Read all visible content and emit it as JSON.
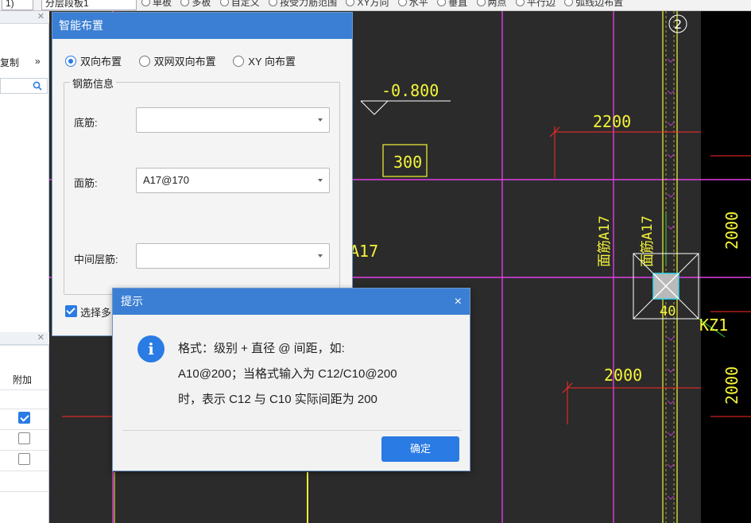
{
  "toolbar": {
    "floor_prefix": "1)",
    "floor_select": "分层段板1",
    "options": [
      "单板",
      "多板",
      "自定义",
      "按受力筋范围",
      "XY方向",
      "水平",
      "垂直",
      "两点",
      "平行边",
      "弧线边布置"
    ]
  },
  "left_panel": {
    "copy_label": "复制",
    "more_glyph": "»",
    "attach_header": "附加",
    "rows": [
      {
        "checked": true
      },
      {
        "checked": false
      },
      {
        "checked": false
      }
    ]
  },
  "smart_dialog": {
    "title": "智能布置",
    "radio_options": [
      {
        "label": "双向布置",
        "selected": true
      },
      {
        "label": "双网双向布置",
        "selected": false
      },
      {
        "label": "XY 向布置",
        "selected": false
      }
    ],
    "group_label": "钢筋信息",
    "fields": [
      {
        "label": "底筋:",
        "value": ""
      },
      {
        "label": "面筋:",
        "value": "A17@170"
      },
      {
        "label": "中间层筋:",
        "value": ""
      }
    ],
    "select_multi_label": "选择多"
  },
  "tip_dialog": {
    "title": "提示",
    "close_glyph": "×",
    "lines": [
      "格式：级别 + 直径 @ 间距，如:",
      "A10@200；当格式输入为 C12/C10@200",
      "时，表示 C12 与 C10 实际间距为 200"
    ],
    "ok_label": "确定"
  },
  "cad": {
    "elevation": "-0.800",
    "boxed_dim": "300",
    "dim_2200": "2200",
    "dim_2000_h": "2000",
    "dim_2000_v_top": "2000",
    "dim_2000_v_bottom": "2000",
    "rebar_left": "A17",
    "rebar_vertical_1": "面筋A17",
    "rebar_vertical_2": "面筋A17",
    "column_label": "KZ1",
    "column_partial": "40",
    "axis_number": "2",
    "colors": {
      "background": "#2b2b2b",
      "magenta": "#e23ce6",
      "yellow": "#f5f53a",
      "red": "#ff2a2a",
      "green": "#3ad43a",
      "cyan": "#38d7ee"
    }
  }
}
